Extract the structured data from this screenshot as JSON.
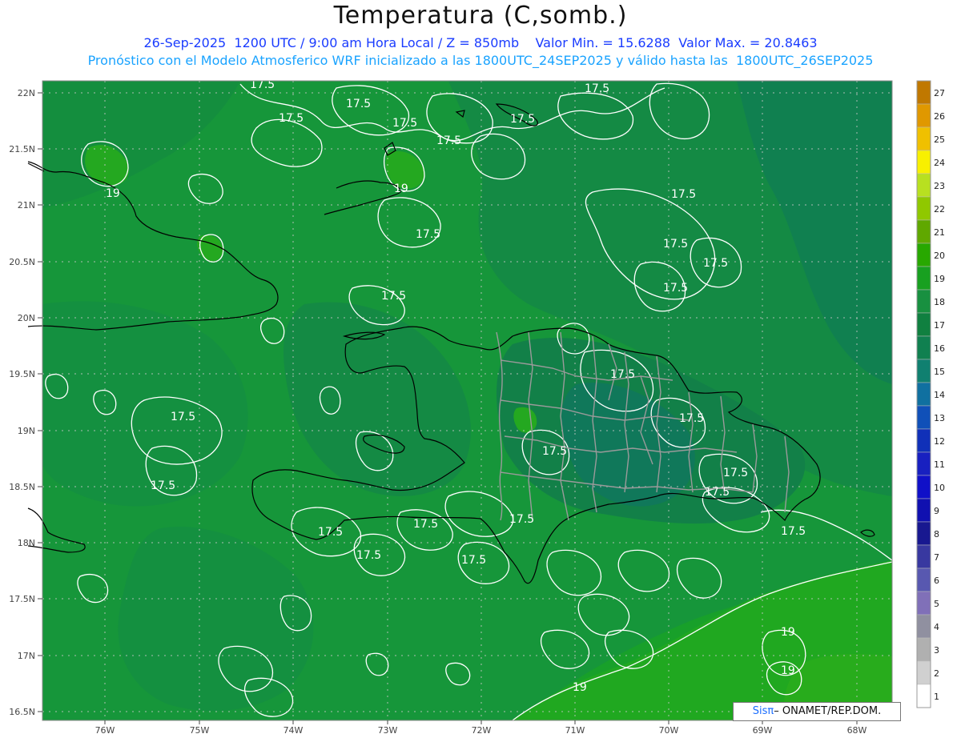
{
  "header": {
    "title": "Temperatura (C,somb.)",
    "subtitle_1": "26-Sep-2025  1200 UTC / 9:00 am Hora Local / Z = 850mb    Valor Min. = 15.6288  Valor Max. = 20.8463",
    "subtitle_2": "Pronóstico con el Modelo Atmosferico WRF inicializado a las 1800UTC_24SEP2025 y válido hasta las  1800UTC_26SEP2025"
  },
  "map": {
    "lat_labels": [
      "22N",
      "21.5N",
      "21N",
      "20.5N",
      "20N",
      "19.5N",
      "19N",
      "18.5N",
      "18N",
      "17.5N",
      "17N",
      "16.5N"
    ],
    "lon_labels": [
      "76W",
      "75W",
      "74W",
      "73W",
      "72W",
      "71W",
      "70W",
      "69W",
      "68W"
    ],
    "contour_labels": [
      {
        "text": "17.5"
      },
      {
        "text": "17.5"
      },
      {
        "text": "17.5"
      },
      {
        "text": "17.5"
      },
      {
        "text": "17.5"
      },
      {
        "text": "17.5"
      },
      {
        "text": "17.5"
      },
      {
        "text": "17.5"
      },
      {
        "text": "17.5"
      },
      {
        "text": "17.5"
      },
      {
        "text": "17.5"
      },
      {
        "text": "17.5"
      },
      {
        "text": "17.5"
      },
      {
        "text": "17.5"
      },
      {
        "text": "17.5"
      },
      {
        "text": "17.5"
      },
      {
        "text": "17.5"
      },
      {
        "text": "17.5"
      },
      {
        "text": "17.5"
      },
      {
        "text": "17.5"
      },
      {
        "text": "17.5"
      },
      {
        "text": "17.5"
      },
      {
        "text": "17.5"
      },
      {
        "text": "17.5"
      },
      {
        "text": "17.5"
      },
      {
        "text": "17.5"
      },
      {
        "text": "19"
      },
      {
        "text": "19"
      },
      {
        "text": "19"
      },
      {
        "text": "19"
      },
      {
        "text": "19"
      }
    ]
  },
  "colorbar": {
    "levels": [
      "27",
      "26",
      "25",
      "24",
      "23",
      "22",
      "21",
      "20",
      "19",
      "18",
      "17",
      "16",
      "15",
      "14",
      "13",
      "12",
      "11",
      "10",
      "9",
      "8",
      "7",
      "6",
      "5",
      "4",
      "3",
      "2",
      "1"
    ],
    "colors": [
      "#c07800",
      "#e09800",
      "#f0c000",
      "#f8f000",
      "#b8e020",
      "#90c800",
      "#60a800",
      "#28a800",
      "#18a020",
      "#189040",
      "#108040",
      "#108050",
      "#108070",
      "#1070a0",
      "#1050b8",
      "#1030b8",
      "#1820c0",
      "#1010c8",
      "#1010b0",
      "#181890",
      "#3838a0",
      "#5858b0",
      "#8070b8",
      "#9090a0",
      "#b0b0b0",
      "#d0d0d0",
      "#ffffff"
    ]
  },
  "credit": {
    "sis": "Sisπ",
    "text": " ONAMET/REP.DOM."
  }
}
